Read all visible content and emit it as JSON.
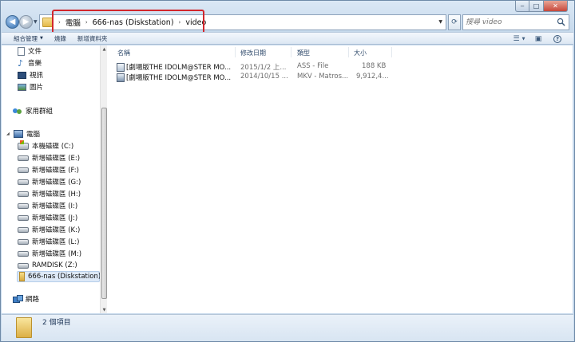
{
  "window": {
    "caption_buttons": {
      "minimize": "‒",
      "maximize": "□",
      "close": "✕"
    }
  },
  "address": {
    "crumbs": [
      "電腦",
      "666-nas (Diskstation)",
      "video"
    ],
    "separator": "›",
    "highlight_color": "#d2262c"
  },
  "search": {
    "placeholder": "搜尋 video"
  },
  "toolbar": {
    "organize_label": "組合管理",
    "burn_label": "燒錄",
    "new_folder_label": "新增資料夾"
  },
  "nav": {
    "libraries": [
      {
        "label": "文件",
        "icon": "document-icon"
      },
      {
        "label": "音樂",
        "icon": "music-icon"
      },
      {
        "label": "視訊",
        "icon": "video-icon"
      },
      {
        "label": "圖片",
        "icon": "pictures-icon"
      }
    ],
    "homegroup": "家用群組",
    "computer": "電腦",
    "drives": [
      "本機磁碟 (C:)",
      "新增磁碟區 (E:)",
      "新增磁碟區 (F:)",
      "新增磁碟區 (G:)",
      "新增磁碟區 (H:)",
      "新增磁碟區 (I:)",
      "新增磁碟區 (J:)",
      "新增磁碟區 (K:)",
      "新增磁碟區 (L:)",
      "新增磁碟區 (M:)",
      "RAMDISK (Z:)",
      "666-nas (Diskstation)"
    ],
    "network": "網路"
  },
  "columns": {
    "name": "名稱",
    "modified": "修改日期",
    "type": "類型",
    "size": "大小"
  },
  "files": [
    {
      "name": "[劇場版THE IDOLM@STER MO...",
      "modified": "2015/1/2 上...",
      "type": "ASS - File",
      "size": "188 KB",
      "icon": "ass-file-icon"
    },
    {
      "name": "[劇場版THE IDOLM@STER MO...",
      "modified": "2014/10/15 ...",
      "type": "MKV - Matros...",
      "size": "9,912,4...",
      "icon": "mkv-file-icon"
    }
  ],
  "status": {
    "item_count": "2 個項目"
  }
}
